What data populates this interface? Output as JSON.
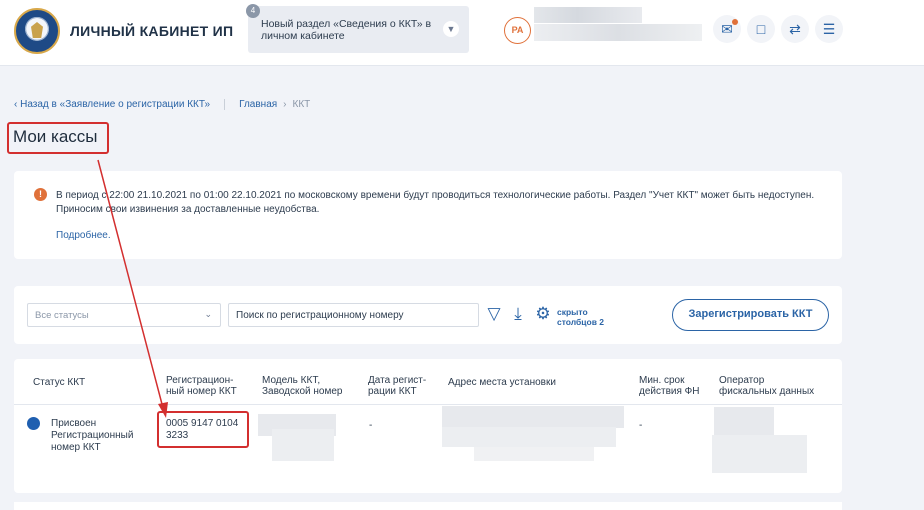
{
  "header": {
    "brand": "ЛИЧНЫЙ КАБИНЕТ ИП",
    "news_count": "4",
    "news_text": "Новый раздел «Сведения о ККТ» в личном кабинете",
    "avatar_initials": "РА"
  },
  "breadcrumbs": {
    "back": "Назад в «Заявление о регистрации ККТ»",
    "home": "Главная",
    "current": "ККТ"
  },
  "page_title": "Мои кассы",
  "notice": {
    "text": "В период с 22:00 21.10.2021 по 01:00 22.10.2021 по московскому времени будут проводиться технологические работы. Раздел \"Учет ККТ\" может быть недоступен. Приносим свои извинения за доставленные неудобства.",
    "more": "Подробнее."
  },
  "filters": {
    "status_select": "Все статусы",
    "search_placeholder": "Поиск по регистрационному номеру",
    "hidden_columns_line1": "скрыто",
    "hidden_columns_line2": "столбцов 2",
    "register_button": "Зарегистрировать ККТ"
  },
  "table": {
    "headers": {
      "status": "Статус ККТ",
      "reg_number_1": "Регистрацион-",
      "reg_number_2": "ный номер ККТ",
      "model_1": "Модель ККТ,",
      "model_2": "Заводской номер",
      "reg_date_1": "Дата регист-",
      "reg_date_2": "рации ККТ",
      "address": "Адрес места установки",
      "fn_1": "Мин. срок",
      "fn_2": "действия ФН",
      "ofd_1": "Оператор",
      "ofd_2": "фискальных данных"
    },
    "row": {
      "status_1": "Присвоен",
      "status_2": "Регистрационный",
      "status_3": "номер ККТ",
      "reg_number_1": "0005 9147 0104",
      "reg_number_2": "3233",
      "reg_date": "-",
      "fn_term": "-"
    }
  },
  "colors": {
    "accent": "#2b64a6",
    "highlight": "#d32f2f",
    "warning": "#e0713a"
  }
}
